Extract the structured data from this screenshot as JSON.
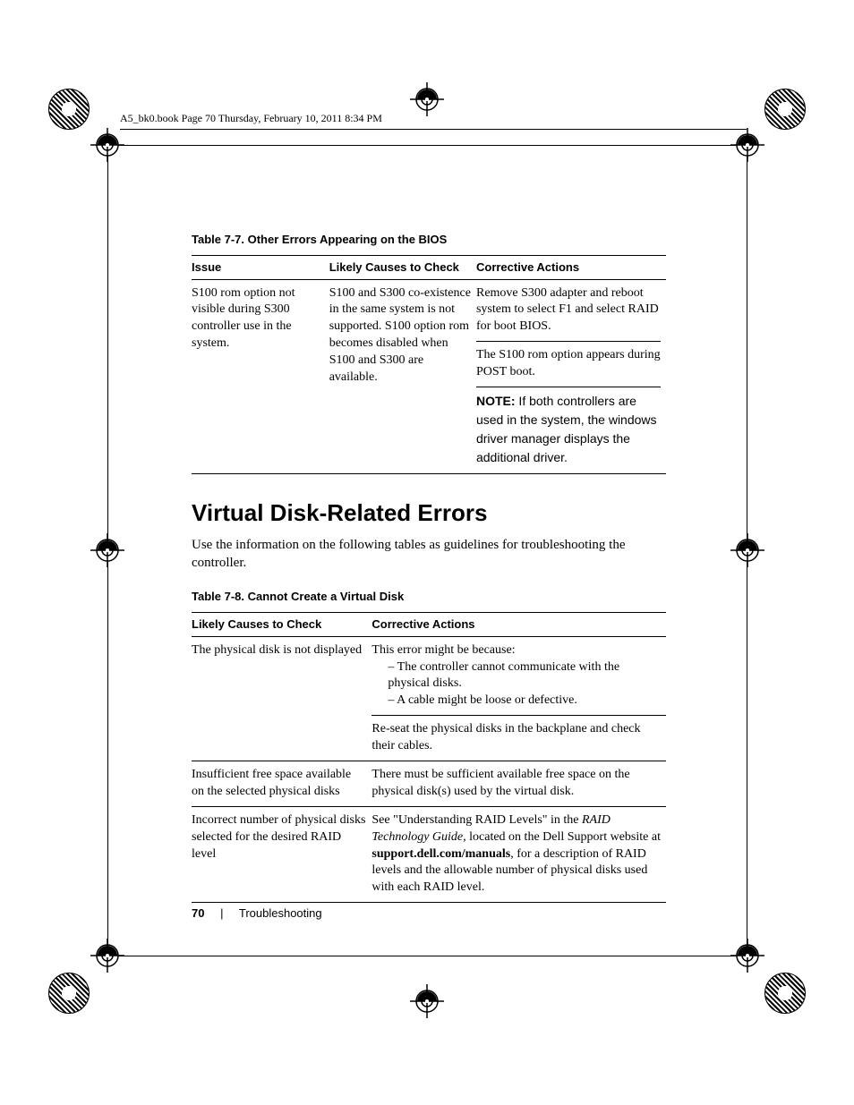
{
  "running_head": "A5_bk0.book  Page 70  Thursday, February 10, 2011  8:34 PM",
  "table77": {
    "caption": "Table 7-7.    Other Errors Appearing on the BIOS",
    "headers": {
      "c1": "Issue",
      "c2": "Likely Causes to Check",
      "c3": "Corrective Actions"
    },
    "row": {
      "issue": "S100 rom option not visible during S300 controller use in the system.",
      "cause": "S100 and S300 co-existence in the same system is not supported. S100 option rom becomes disabled when S100 and S300 are available.",
      "action_p1": "Remove S300 adapter and reboot system to select F1 and select RAID for boot BIOS.",
      "action_p2": "The S100 rom option appears during POST boot.",
      "note_label": "NOTE:",
      "note_body": " If both controllers are used in the system, the windows driver manager displays the additional driver."
    }
  },
  "section_title": "Virtual Disk-Related Errors",
  "section_intro": "Use the information on the following tables as guidelines for troubleshooting the controller.",
  "table78": {
    "caption": "Table 7-8.    Cannot Create a Virtual Disk",
    "headers": {
      "c1": "Likely Causes to Check",
      "c2": "Corrective Actions"
    },
    "rows": [
      {
        "cause": "The physical disk is not displayed",
        "action_intro": "This error might be because:",
        "action_bullets": [
          "– The controller cannot communicate with the physical disks.",
          "– A cable might be loose or defective."
        ],
        "action_after": "Re-seat the physical disks in the backplane and check their cables."
      },
      {
        "cause": "Insufficient free space available on the selected physical disks",
        "action": "There must be sufficient available free space on the physical disk(s) used by the virtual disk."
      },
      {
        "cause": "Incorrect number of physical disks selected for the desired RAID level",
        "action_pre": "See \"Understanding RAID Levels\" in the ",
        "action_em": "RAID Technology Guide",
        "action_mid": ", located on the Dell Support website at ",
        "action_url": "support.dell.com/manuals",
        "action_post": ", for a description of RAID levels and the allowable number of physical disks used with each RAID level."
      }
    ]
  },
  "footer": {
    "page_number": "70",
    "section": "Troubleshooting"
  }
}
